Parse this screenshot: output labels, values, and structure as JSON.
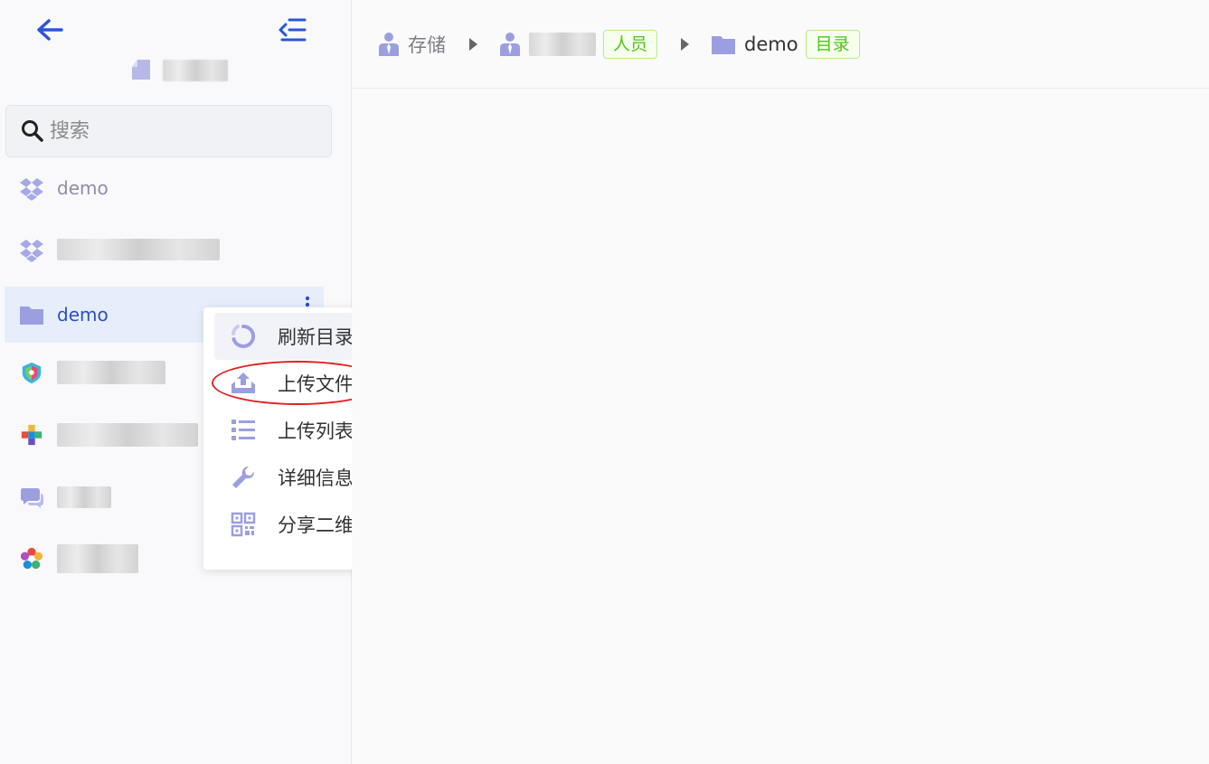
{
  "sidebar": {
    "user": {
      "name": "███████"
    },
    "search": {
      "placeholder": "搜索"
    },
    "items": [
      {
        "label": "demo",
        "icon": "dropbox-icon"
      },
      {
        "label": "██████████████",
        "icon": "dropbox-icon"
      },
      {
        "label": "demo",
        "icon": "folder-icon",
        "active": true
      },
      {
        "label": "██████",
        "icon": "app-shield-icon"
      },
      {
        "label": "████████",
        "icon": "app-puzzle-icon"
      },
      {
        "label": "███",
        "icon": "chat-icon"
      },
      {
        "label": "█████",
        "icon": "app-flower-icon"
      }
    ]
  },
  "context_menu": {
    "items": [
      {
        "label": "刷新目录",
        "icon": "refresh-icon"
      },
      {
        "label": "上传文件",
        "icon": "upload-icon"
      },
      {
        "label": "上传列表",
        "icon": "list-icon"
      },
      {
        "label": "详细信息",
        "icon": "wrench-icon"
      },
      {
        "label": "分享二维码",
        "icon": "qrcode-icon"
      }
    ]
  },
  "breadcrumb": {
    "items": [
      {
        "label": "存储",
        "icon": "person-icon",
        "tag": ""
      },
      {
        "label": "██████",
        "icon": "person-icon",
        "tag": "人员"
      },
      {
        "label": "demo",
        "icon": "folder-icon",
        "tag": "目录"
      }
    ]
  },
  "colors": {
    "accent": "#2e4fc4",
    "icon": "#9b9fe0",
    "tag_green": "#52c41a",
    "highlight": "#e02020"
  }
}
